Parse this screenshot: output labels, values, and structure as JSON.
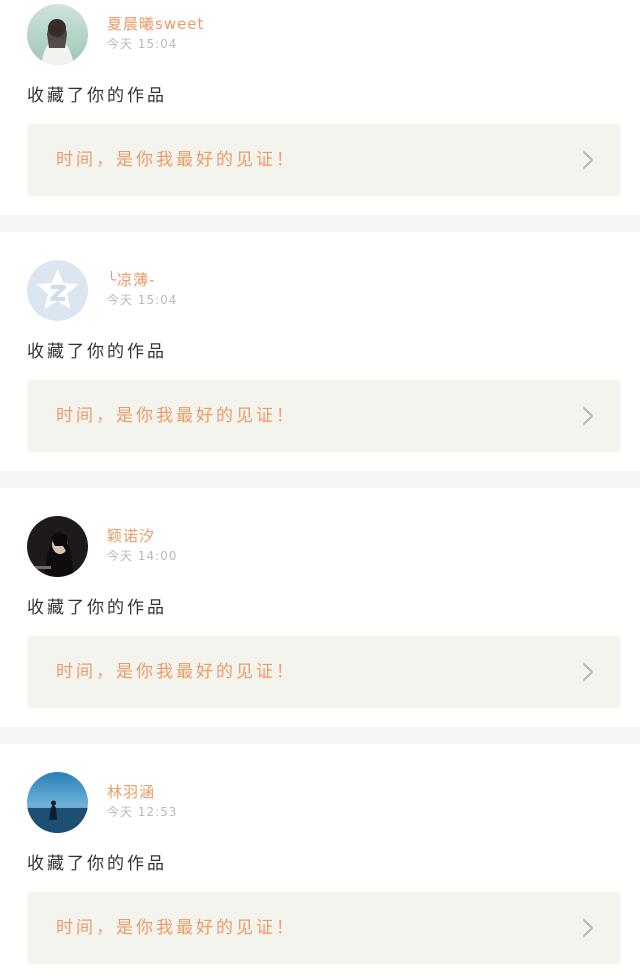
{
  "feed": [
    {
      "username": "夏晨曦sweet",
      "timestamp": "今天 15:04",
      "action": "收藏了你的作品",
      "work_title": "时间，是你我最好的见证！",
      "avatar_icon": "photo-girl-camera-avatar"
    },
    {
      "username": "╰凉薄-",
      "timestamp": "今天 15:04",
      "action": "收藏了你的作品",
      "work_title": "时间，是你我最好的见证！",
      "avatar_icon": "qq-default-star-avatar"
    },
    {
      "username": "颖诺汐",
      "timestamp": "今天 14:00",
      "action": "收藏了你的作品",
      "work_title": "时间，是你我最好的见证！",
      "avatar_icon": "photo-woman-dark-avatar"
    },
    {
      "username": "林羽涵",
      "timestamp": "今天 12:53",
      "action": "收藏了你的作品",
      "work_title": "时间，是你我最好的见证！",
      "avatar_icon": "photo-sea-sky-avatar"
    }
  ],
  "colors": {
    "accent": "#ec9a66",
    "card_background": "#f4f4ee",
    "divider": "#f5f5f5",
    "timestamp": "#b9b9b9",
    "body_text": "#333333"
  }
}
